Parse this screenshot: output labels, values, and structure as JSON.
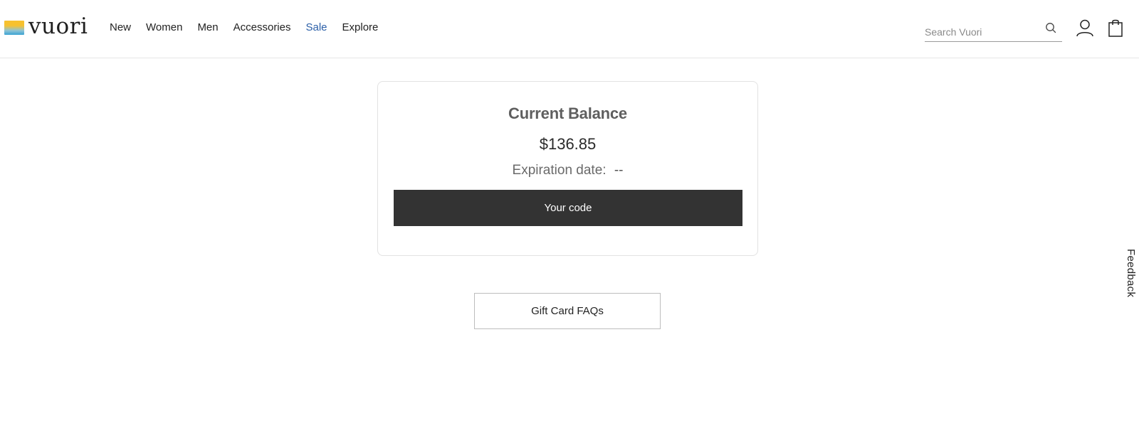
{
  "header": {
    "logo_text": "vuori",
    "nav": [
      {
        "label": "New"
      },
      {
        "label": "Women"
      },
      {
        "label": "Men"
      },
      {
        "label": "Accessories"
      },
      {
        "label": "Sale"
      },
      {
        "label": "Explore"
      }
    ],
    "search": {
      "placeholder": "Search Vuori",
      "value": ""
    },
    "icons": {
      "search": "search-icon",
      "account": "account-icon",
      "bag": "shopping-bag-icon"
    },
    "colors": {
      "sale": "#2b5fa8"
    }
  },
  "balance_card": {
    "title": "Current Balance",
    "amount": "$136.85",
    "expiration_label": "Expiration date:",
    "expiration_value": "--",
    "code_button_label": "Your code",
    "button_color": "#333333"
  },
  "faq_button_label": "Gift Card FAQs",
  "feedback_label": "Feedback"
}
